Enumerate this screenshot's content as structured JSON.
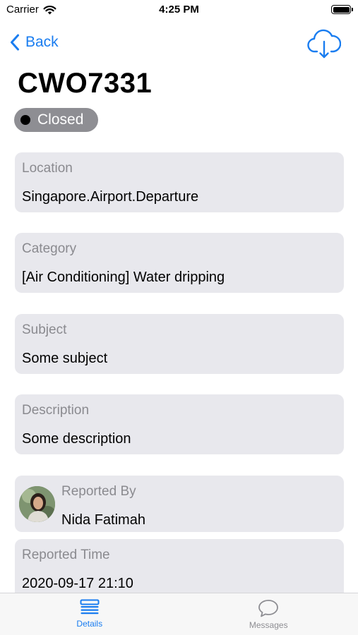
{
  "status_bar": {
    "carrier": "Carrier",
    "time": "4:25 PM"
  },
  "nav": {
    "back_label": "Back"
  },
  "title": "CWO7331",
  "status": {
    "label": "Closed"
  },
  "cards": {
    "location": {
      "label": "Location",
      "value": "Singapore.Airport.Departure"
    },
    "category": {
      "label": "Category",
      "value": "[Air Conditioning] Water dripping"
    },
    "subject": {
      "label": "Subject",
      "value": "Some subject"
    },
    "description": {
      "label": "Description",
      "value": "Some description"
    },
    "reported_by": {
      "label": "Reported By",
      "value": "Nida Fatimah"
    },
    "reported_time": {
      "label": "Reported Time",
      "value": "2020-09-17 21:10"
    }
  },
  "tabs": [
    {
      "label": "Details",
      "icon": "list-icon",
      "active": true
    },
    {
      "label": "Messages",
      "icon": "chat-bubble-icon",
      "active": false
    }
  ],
  "colors": {
    "accent": "#1a7df0",
    "card_bg": "#e8e8ed",
    "badge_bg": "#8e8e93"
  }
}
